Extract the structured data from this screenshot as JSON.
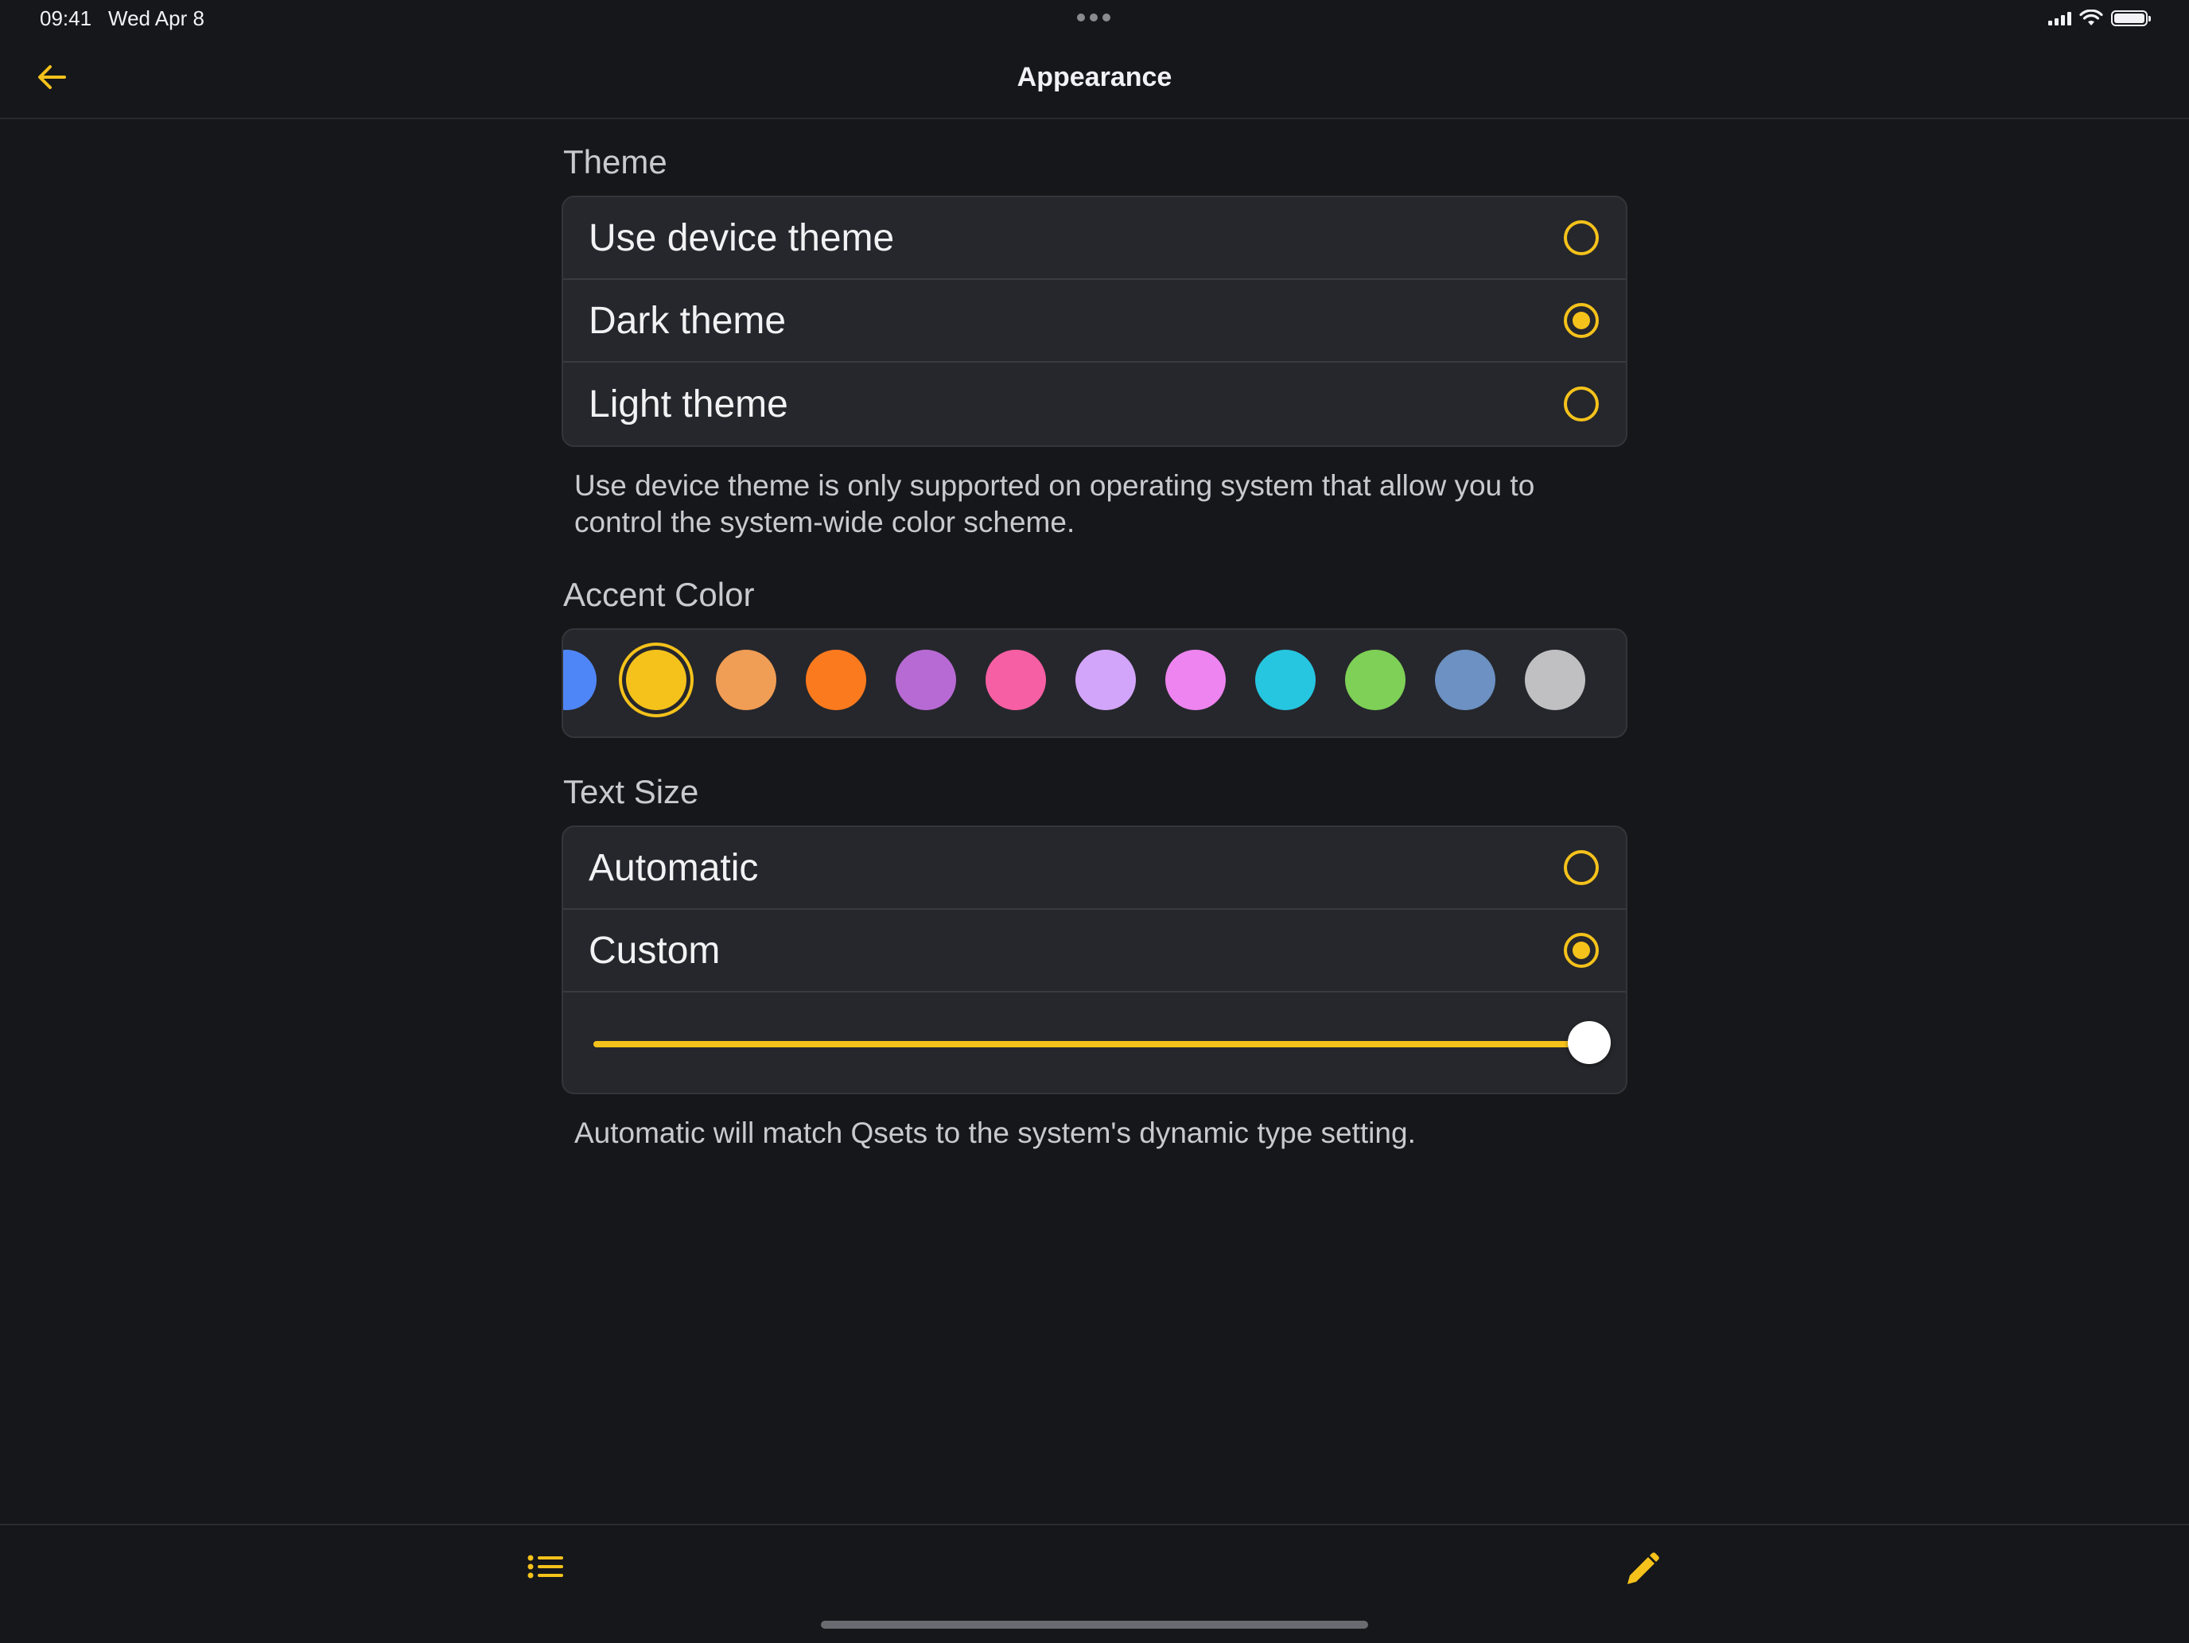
{
  "status_bar": {
    "time": "09:41",
    "date": "Wed Apr 8"
  },
  "nav": {
    "title": "Appearance",
    "back_icon": "arrow-left-icon"
  },
  "theme": {
    "title": "Theme",
    "options": [
      {
        "label": "Use device theme",
        "selected": false
      },
      {
        "label": "Dark theme",
        "selected": true
      },
      {
        "label": "Light theme",
        "selected": false
      }
    ],
    "footnote": "Use device theme is only supported on operating system that allow you to control the system-wide color scheme."
  },
  "accent": {
    "title": "Accent Color",
    "selected_index": 1,
    "colors": [
      "#4f86f7",
      "#f5c21b",
      "#f09d55",
      "#fc7a1e",
      "#b76ad4",
      "#f75fa5",
      "#d2a5fa",
      "#ee84f0",
      "#26c5e0",
      "#7ed057",
      "#6c91c2",
      "#c0c0c2"
    ]
  },
  "text_size": {
    "title": "Text Size",
    "options": [
      {
        "label": "Automatic",
        "selected": false
      },
      {
        "label": "Custom",
        "selected": true
      }
    ],
    "slider_value": 1.0,
    "footnote": "Automatic will match Qsets to the system's dynamic type setting."
  },
  "toolbar": {
    "left_icon": "list-icon",
    "right_icon": "pencil-icon"
  },
  "accent_color": "#f5c21b"
}
